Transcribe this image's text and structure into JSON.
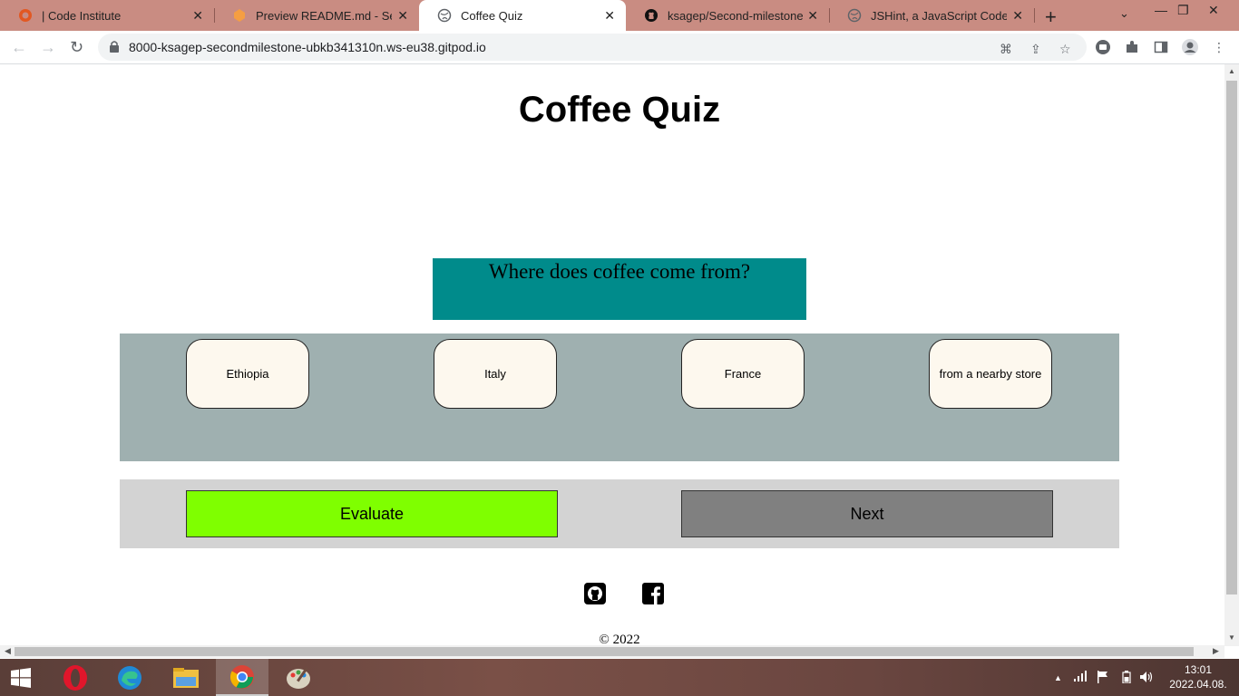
{
  "browser": {
    "tabs": [
      {
        "title": "| Code Institute",
        "favicon": "code-institute-icon",
        "color": "#e25822"
      },
      {
        "title": "Preview README.md - Second",
        "favicon": "gitpod-icon",
        "color": "#f59e42"
      },
      {
        "title": "Coffee Quiz",
        "favicon": "globe-icon",
        "color": "#5f6368"
      },
      {
        "title": "ksagep/Second-milestone-pro",
        "favicon": "github-icon",
        "color": "#111"
      },
      {
        "title": "JSHint, a JavaScript Code Qual",
        "favicon": "globe-icon",
        "color": "#5f6368"
      }
    ],
    "url": "8000-ksagep-secondmilestone-ubkb341310n.ws-eu38.gitpod.io"
  },
  "page": {
    "title": "Coffee Quiz",
    "question": "Where does coffee come from?",
    "answers": [
      "Ethiopia",
      "Italy",
      "France",
      "from a nearby store"
    ],
    "evaluate_label": "Evaluate",
    "next_label": "Next",
    "copyright": "© 2022"
  },
  "colors": {
    "question_bg": "#008b8b",
    "answers_bg": "#9fb0b0",
    "evaluate_bg": "#7fff00",
    "next_bg": "#808080"
  },
  "taskbar": {
    "apps": [
      "windows-start-icon",
      "opera-icon",
      "edge-icon",
      "file-explorer-icon",
      "chrome-icon",
      "paint-icon"
    ],
    "time": "13:01",
    "date": "2022.04.08."
  }
}
